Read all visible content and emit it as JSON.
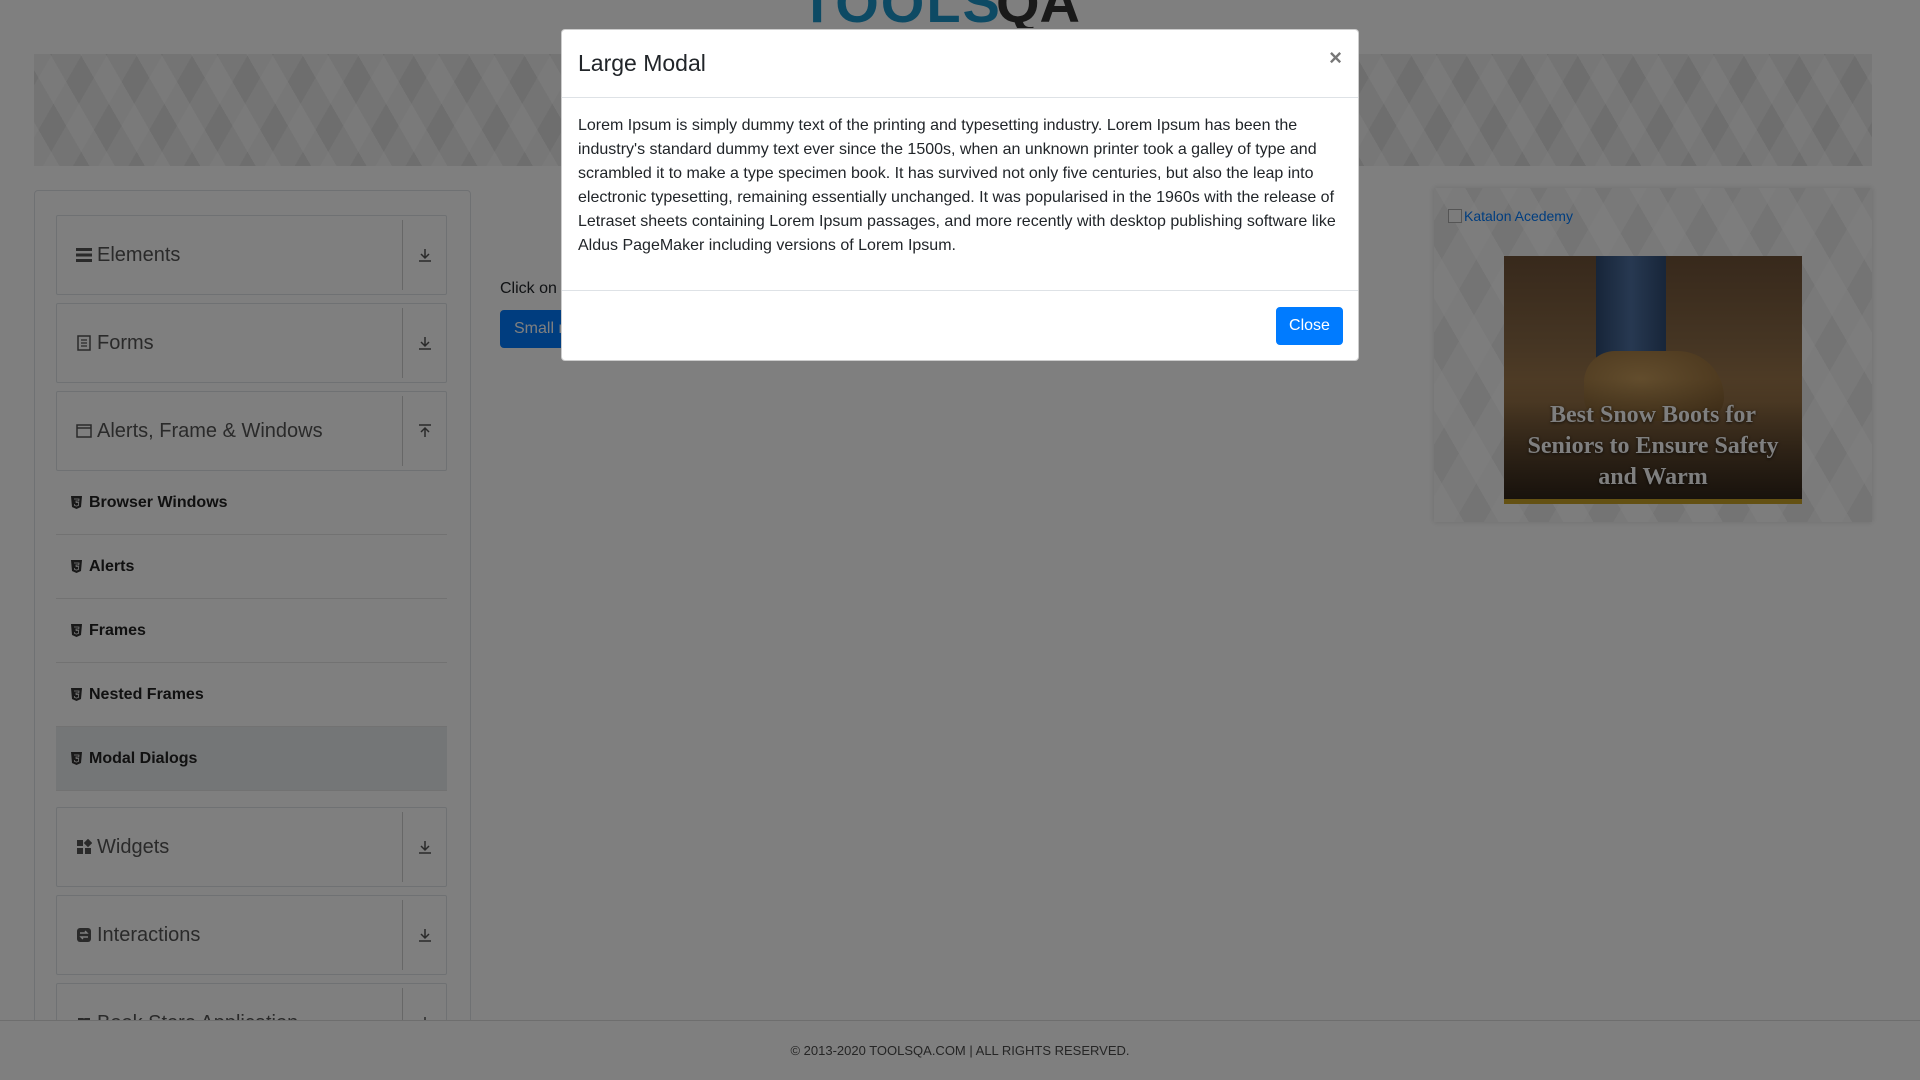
{
  "header": {
    "logo_tools": "TOOLS",
    "logo_qa": "QA"
  },
  "sidebar": {
    "groups": [
      {
        "label": "Elements",
        "icon": "hamburger-icon",
        "expanded": false
      },
      {
        "label": "Forms",
        "icon": "document-icon",
        "expanded": false
      },
      {
        "label": "Alerts, Frame & Windows",
        "icon": "window-icon",
        "expanded": true
      },
      {
        "label": "Widgets",
        "icon": "grid-icon",
        "expanded": false
      },
      {
        "label": "Interactions",
        "icon": "interactions-icon",
        "expanded": false
      },
      {
        "label": "Book Store Application",
        "icon": "book-icon",
        "expanded": false
      }
    ],
    "items": [
      {
        "label": "Browser Windows",
        "icon": "html5-icon"
      },
      {
        "label": "Alerts",
        "icon": "html5-icon"
      },
      {
        "label": "Frames",
        "icon": "html5-icon"
      },
      {
        "label": "Nested Frames",
        "icon": "html5-icon"
      },
      {
        "label": "Modal Dialogs",
        "icon": "html5-icon",
        "active": true
      }
    ]
  },
  "main": {
    "instruction": "Click on",
    "small_modal_button": "Small m"
  },
  "ad": {
    "link_alt": "Katalon Acedemy",
    "title": "Best Snow Boots for Seniors to Ensure Safety and Warm"
  },
  "modal": {
    "title": "Large Modal",
    "close_x": "×",
    "body": "Lorem Ipsum is simply dummy text of the printing and typesetting industry. Lorem Ipsum has been the industry's standard dummy text ever since the 1500s, when an unknown printer took a galley of type and scrambled it to make a type specimen book. It has survived not only five centuries, but also the leap into electronic typesetting, remaining essentially unchanged. It was popularised in the 1960s with the release of Letraset sheets containing Lorem Ipsum passages, and more recently with desktop publishing software like Aldus PageMaker including versions of Lorem Ipsum.",
    "close_button": "Close"
  },
  "footer": {
    "text": "© 2013-2020 TOOLSQA.COM | ALL RIGHTS RESERVED."
  },
  "colors": {
    "primary": "#007bff",
    "overlay": "rgba(0,0,0,0.5)",
    "logo_blue": "#1b95c9"
  }
}
